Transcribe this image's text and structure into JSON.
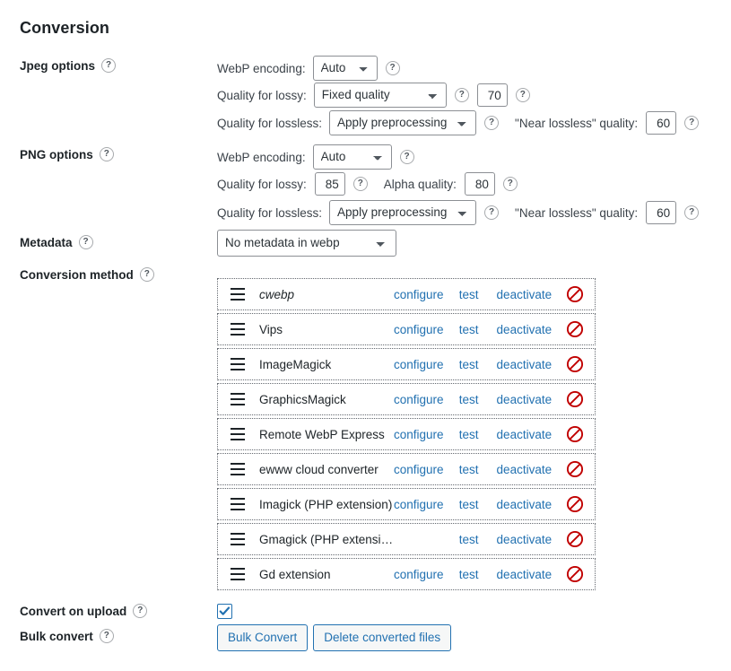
{
  "page": {
    "title": "Conversion",
    "help_glyph": "?"
  },
  "jpeg": {
    "label": "Jpeg options",
    "encoding_label": "WebP encoding:",
    "encoding_value": "Auto",
    "encoding_options": [
      "Auto"
    ],
    "lossy_label": "Quality for lossy:",
    "lossy_value": "Fixed quality",
    "lossy_options": [
      "Fixed quality"
    ],
    "lossy_quality": "70",
    "lossless_label": "Quality for lossless:",
    "lossless_value": "Apply preprocessing",
    "lossless_options": [
      "Apply preprocessing"
    ],
    "near_lossless_label": "\"Near lossless\" quality:",
    "near_lossless_value": "60"
  },
  "png": {
    "label": "PNG options",
    "encoding_label": "WebP encoding:",
    "encoding_value": "Auto",
    "encoding_options": [
      "Auto"
    ],
    "lossy_label": "Quality for lossy:",
    "lossy_quality": "85",
    "alpha_label": "Alpha quality:",
    "alpha_value": "80",
    "lossless_label": "Quality for lossless:",
    "lossless_value": "Apply preprocessing",
    "lossless_options": [
      "Apply preprocessing"
    ],
    "near_lossless_label": "\"Near lossless\" quality:",
    "near_lossless_value": "60"
  },
  "metadata": {
    "label": "Metadata",
    "value": "No metadata in webp",
    "options": [
      "No metadata in webp"
    ]
  },
  "conversion_method": {
    "label": "Conversion method",
    "actions": {
      "configure": "configure",
      "test": "test",
      "deactivate": "deactivate"
    },
    "rows": [
      {
        "name": "cwebp",
        "italic": true,
        "configure": true,
        "test": true,
        "deactivate": true,
        "ban": "prohibited-icon"
      },
      {
        "name": "Vips",
        "italic": false,
        "configure": true,
        "test": true,
        "deactivate": true,
        "ban": "prohibited-icon"
      },
      {
        "name": "ImageMagick",
        "italic": false,
        "configure": true,
        "test": true,
        "deactivate": true,
        "ban": "prohibited-icon"
      },
      {
        "name": "GraphicsMagick",
        "italic": false,
        "configure": true,
        "test": true,
        "deactivate": true,
        "ban": "prohibited-icon"
      },
      {
        "name": "Remote WebP Express",
        "italic": false,
        "configure": true,
        "test": true,
        "deactivate": true,
        "ban": "prohibited-icon"
      },
      {
        "name": "ewww cloud converter",
        "italic": false,
        "configure": true,
        "test": true,
        "deactivate": true,
        "ban": "prohibited-icon"
      },
      {
        "name": "Imagick (PHP extension)",
        "italic": false,
        "configure": true,
        "test": true,
        "deactivate": true,
        "ban": "prohibited-icon"
      },
      {
        "name": "Gmagick (PHP extension)",
        "italic": false,
        "configure": false,
        "test": true,
        "deactivate": true,
        "ban": "prohibited-icon"
      },
      {
        "name": "Gd extension",
        "italic": false,
        "configure": true,
        "test": true,
        "deactivate": true,
        "ban": "prohibited-icon"
      }
    ]
  },
  "convert_on_upload": {
    "label": "Convert on upload",
    "checked": true
  },
  "bulk_convert": {
    "label": "Bulk convert",
    "bulk_button": "Bulk Convert",
    "delete_button": "Delete converted files"
  },
  "colors": {
    "link_blue": "#2271b1",
    "ban_red": "#c10000",
    "text_dark": "#1d2327",
    "label_gray": "#3c434a",
    "border_gray": "#8c8f94"
  }
}
